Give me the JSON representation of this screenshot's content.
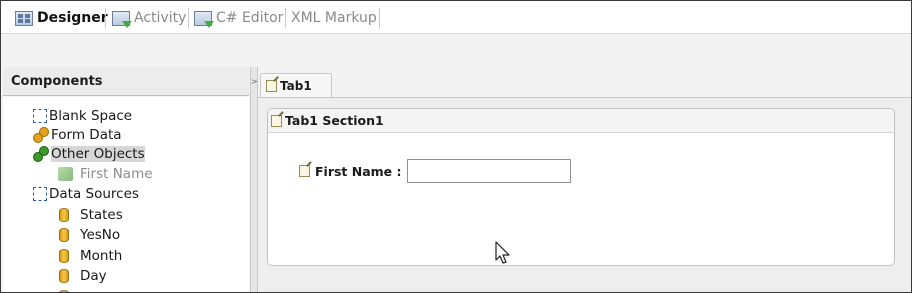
{
  "view_tabs": [
    {
      "label": "Designer",
      "icon": "grid-icon",
      "active": true
    },
    {
      "label": "Activity",
      "icon": "activity-icon",
      "active": false
    },
    {
      "label": "C# Editor",
      "icon": "code-editor-icon",
      "active": false
    },
    {
      "label": "XML Markup",
      "icon": "",
      "active": false
    }
  ],
  "components": {
    "header": "Components",
    "items": [
      {
        "label": "Blank Space",
        "icon": "dashed-box-icon"
      },
      {
        "label": "Form Data",
        "icon": "form-data-icon"
      },
      {
        "label": "Other Objects",
        "icon": "other-objects-icon",
        "selected": true
      },
      {
        "label": "First Name",
        "icon": "object-cube-icon",
        "dim": true
      },
      {
        "label": "Data Sources",
        "icon": "dashed-box-icon"
      },
      {
        "label": "States",
        "icon": "database-icon"
      },
      {
        "label": "YesNo",
        "icon": "database-icon"
      },
      {
        "label": "Month",
        "icon": "database-icon"
      },
      {
        "label": "Day",
        "icon": "database-icon"
      }
    ]
  },
  "splitter_glyph": ">",
  "form_tab": {
    "label": "Tab1"
  },
  "section": {
    "title": "Tab1 Section1"
  },
  "field": {
    "label": "First Name :",
    "value": ""
  },
  "colors": {
    "selection": "#d7d7d7",
    "dashed_icon": "#2a5aa6"
  }
}
